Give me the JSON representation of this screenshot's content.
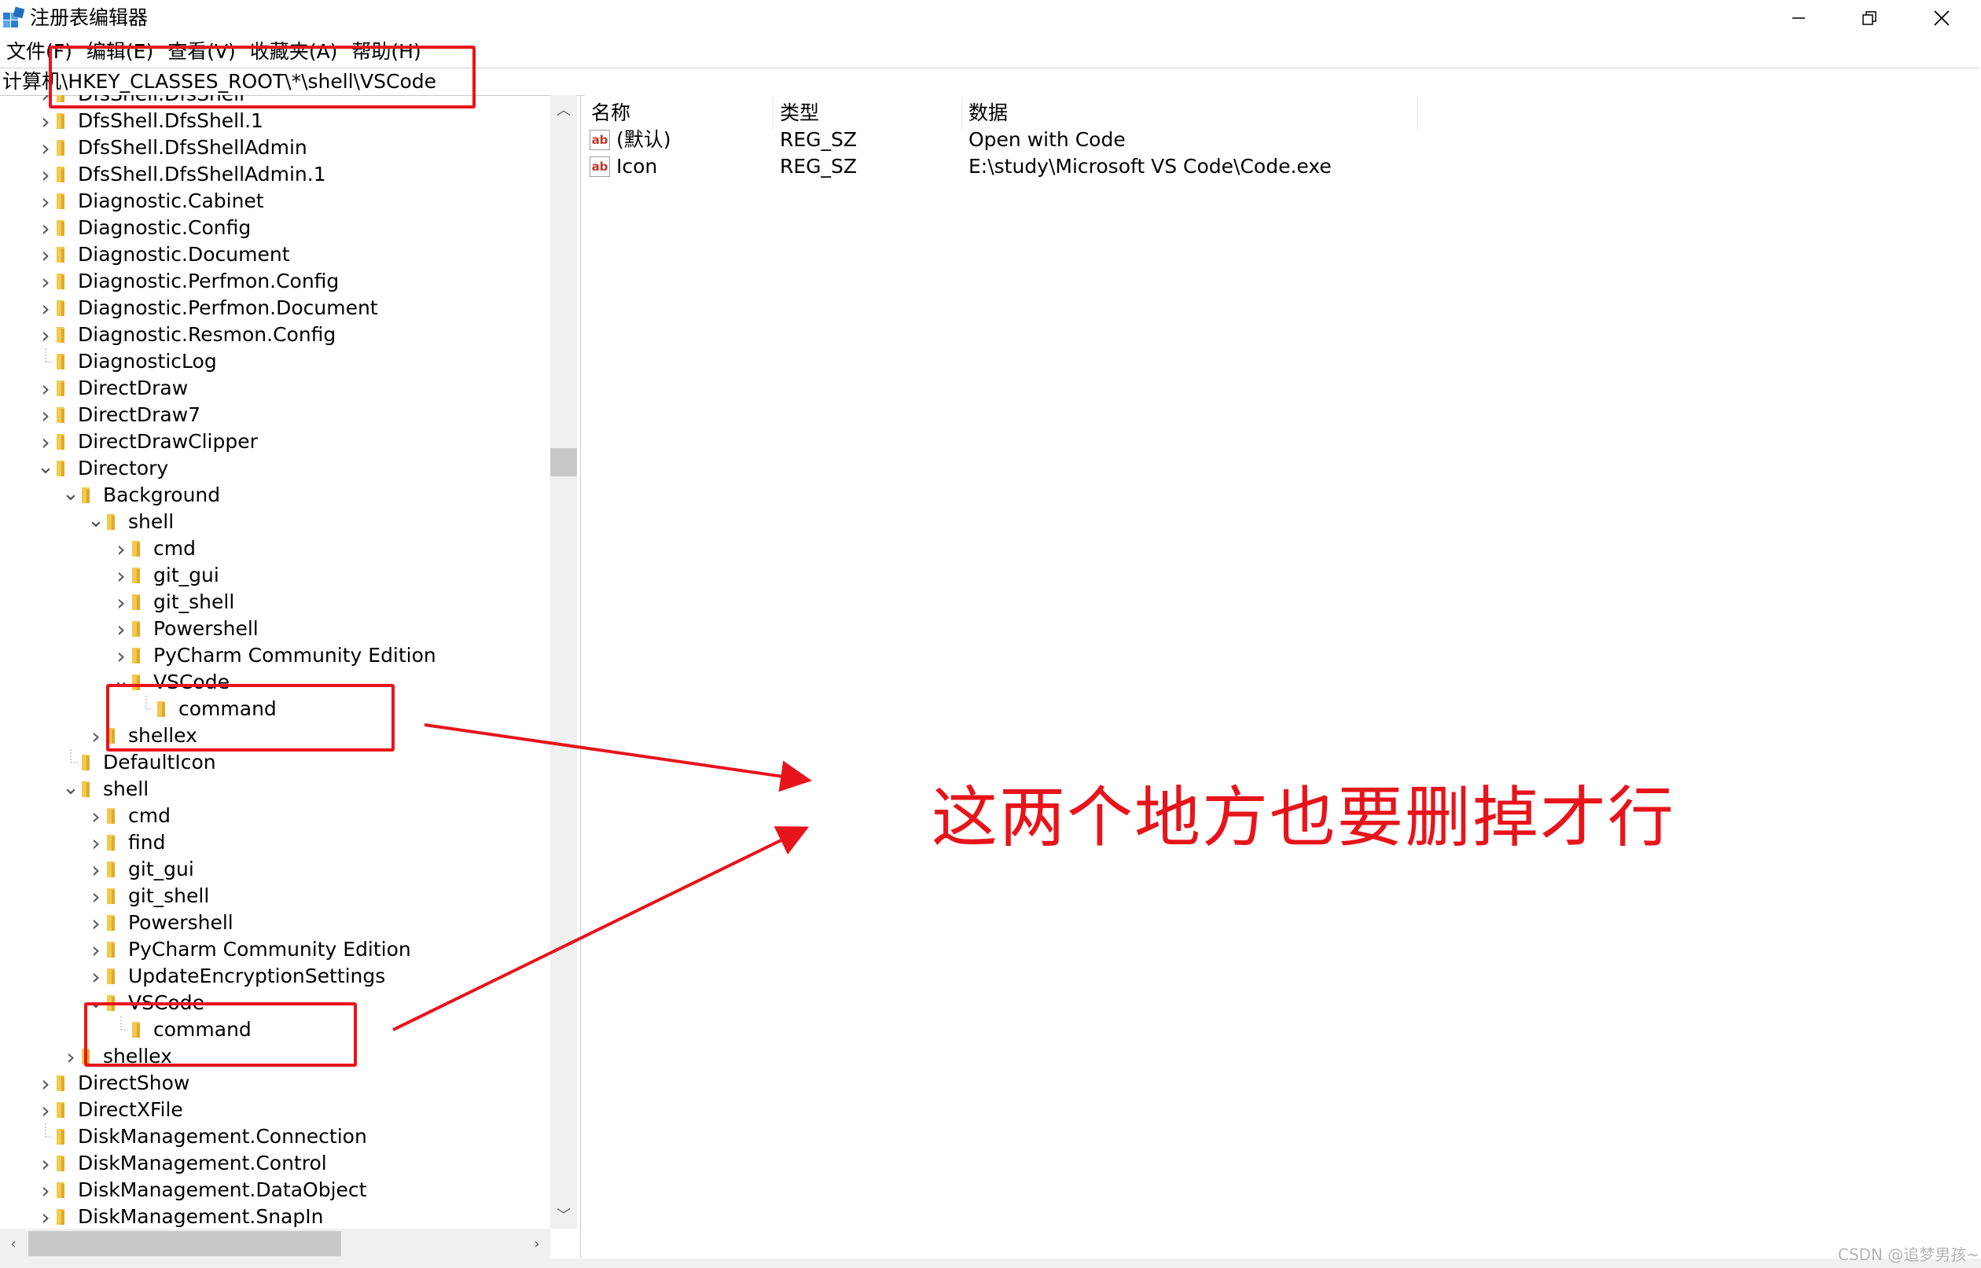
{
  "window": {
    "title": "注册表编辑器",
    "controls": [
      "minimize-icon",
      "restore-icon",
      "close-icon"
    ]
  },
  "menubar": [
    "文件(F)",
    "编辑(E)",
    "查看(V)",
    "收藏夹(A)",
    "帮助(H)"
  ],
  "address": "计算机\\HKEY_CLASSES_ROOT\\*\\shell\\VSCode",
  "tree": {
    "items": [
      {
        "label": "DfsShell.DfsShell",
        "depth": 0,
        "state": "collapsed"
      },
      {
        "label": "DfsShell.DfsShell.1",
        "depth": 0,
        "state": "collapsed"
      },
      {
        "label": "DfsShell.DfsShellAdmin",
        "depth": 0,
        "state": "collapsed"
      },
      {
        "label": "DfsShell.DfsShellAdmin.1",
        "depth": 0,
        "state": "collapsed"
      },
      {
        "label": "Diagnostic.Cabinet",
        "depth": 0,
        "state": "collapsed"
      },
      {
        "label": "Diagnostic.Config",
        "depth": 0,
        "state": "collapsed"
      },
      {
        "label": "Diagnostic.Document",
        "depth": 0,
        "state": "collapsed"
      },
      {
        "label": "Diagnostic.Perfmon.Config",
        "depth": 0,
        "state": "collapsed"
      },
      {
        "label": "Diagnostic.Perfmon.Document",
        "depth": 0,
        "state": "collapsed"
      },
      {
        "label": "Diagnostic.Resmon.Config",
        "depth": 0,
        "state": "collapsed"
      },
      {
        "label": "DiagnosticLog",
        "depth": 0,
        "state": "leaf"
      },
      {
        "label": "DirectDraw",
        "depth": 0,
        "state": "collapsed"
      },
      {
        "label": "DirectDraw7",
        "depth": 0,
        "state": "collapsed"
      },
      {
        "label": "DirectDrawClipper",
        "depth": 0,
        "state": "collapsed"
      },
      {
        "label": "Directory",
        "depth": 0,
        "state": "expanded"
      },
      {
        "label": "Background",
        "depth": 1,
        "state": "expanded"
      },
      {
        "label": "shell",
        "depth": 2,
        "state": "expanded"
      },
      {
        "label": "cmd",
        "depth": 3,
        "state": "collapsed"
      },
      {
        "label": "git_gui",
        "depth": 3,
        "state": "collapsed"
      },
      {
        "label": "git_shell",
        "depth": 3,
        "state": "collapsed"
      },
      {
        "label": "Powershell",
        "depth": 3,
        "state": "collapsed"
      },
      {
        "label": "PyCharm Community Edition",
        "depth": 3,
        "state": "collapsed"
      },
      {
        "label": "VSCode",
        "depth": 3,
        "state": "expanded"
      },
      {
        "label": "command",
        "depth": 4,
        "state": "leaf"
      },
      {
        "label": "shellex",
        "depth": 2,
        "state": "collapsed"
      },
      {
        "label": "DefaultIcon",
        "depth": 1,
        "state": "leaf"
      },
      {
        "label": "shell",
        "depth": 1,
        "state": "expanded"
      },
      {
        "label": "cmd",
        "depth": 2,
        "state": "collapsed"
      },
      {
        "label": "find",
        "depth": 2,
        "state": "collapsed"
      },
      {
        "label": "git_gui",
        "depth": 2,
        "state": "collapsed"
      },
      {
        "label": "git_shell",
        "depth": 2,
        "state": "collapsed"
      },
      {
        "label": "Powershell",
        "depth": 2,
        "state": "collapsed"
      },
      {
        "label": "PyCharm Community Edition",
        "depth": 2,
        "state": "collapsed"
      },
      {
        "label": "UpdateEncryptionSettings",
        "depth": 2,
        "state": "collapsed"
      },
      {
        "label": "VSCode",
        "depth": 2,
        "state": "expanded"
      },
      {
        "label": "command",
        "depth": 3,
        "state": "leaf"
      },
      {
        "label": "shellex",
        "depth": 1,
        "state": "collapsed"
      },
      {
        "label": "DirectShow",
        "depth": 0,
        "state": "collapsed"
      },
      {
        "label": "DirectXFile",
        "depth": 0,
        "state": "collapsed"
      },
      {
        "label": "DiskManagement.Connection",
        "depth": 0,
        "state": "leaf"
      },
      {
        "label": "DiskManagement.Control",
        "depth": 0,
        "state": "collapsed"
      },
      {
        "label": "DiskManagement.DataObject",
        "depth": 0,
        "state": "collapsed"
      },
      {
        "label": "DiskManagement.SnapIn",
        "depth": 0,
        "state": "collapsed"
      }
    ]
  },
  "list": {
    "columns": [
      "名称",
      "类型",
      "数据"
    ],
    "rows": [
      {
        "name": "(默认)",
        "type": "REG_SZ",
        "data": "Open with Code",
        "icon": "ab"
      },
      {
        "name": "Icon",
        "type": "REG_SZ",
        "data": "E:\\study\\Microsoft VS Code\\Code.exe",
        "icon": "ab"
      }
    ]
  },
  "annotation": {
    "text": "这两个地方也要删掉才行",
    "color": "#e8141b"
  },
  "watermark": "CSDN @追梦男孩~.",
  "colors": {
    "folder": "#f2c94c",
    "annotation": "#e8141b"
  }
}
